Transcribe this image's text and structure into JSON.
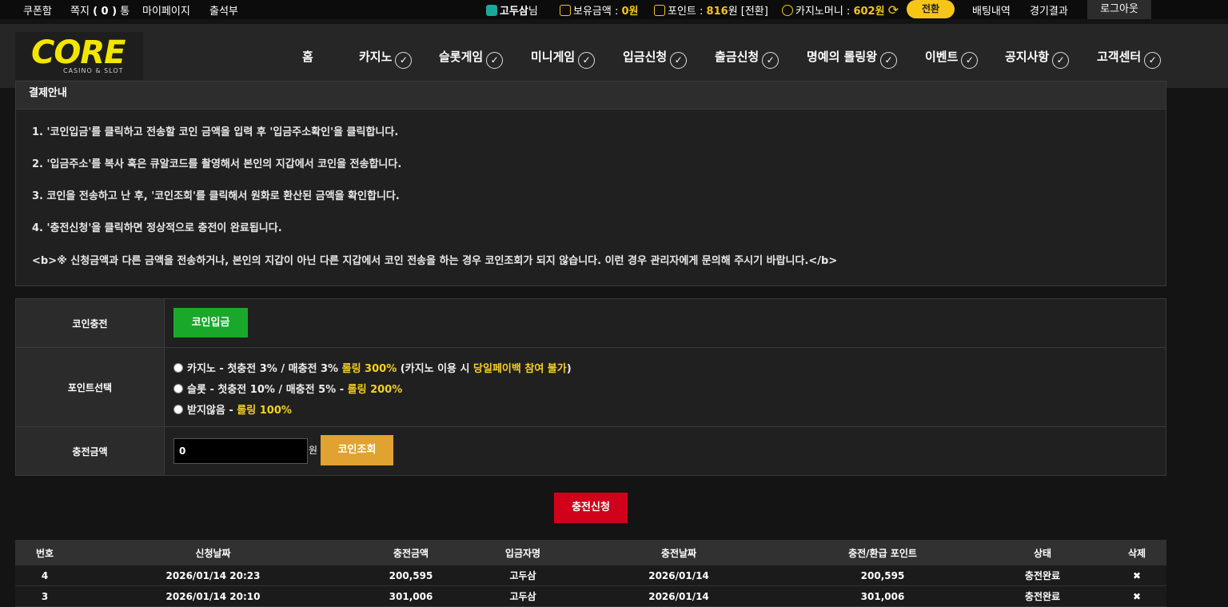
{
  "topbar": {
    "left_links": [
      "쿠폰함",
      "쪽지",
      "마이페이지",
      "출석부"
    ],
    "note_count": "( 0 )",
    "note_suffix": "통",
    "username": "고두삼",
    "username_suffix": "님",
    "balance_label": "보유금액 :",
    "balance_value": "0원",
    "point_label": "포인트 :",
    "point_value": "816",
    "point_suffix": "원 [전환]",
    "casino_label": "카지노머니 :",
    "casino_value": "602원",
    "switch_label": "전환",
    "betting_history": "배팅내역",
    "game_results": "경기결과",
    "logout": "로그아웃",
    "colors": {
      "gold": "#f5c518",
      "user_icon": "#1aa89a"
    }
  },
  "header": {
    "logo_text": "CORE",
    "logo_sub": "CASINO & SLOT",
    "nav": [
      "홈",
      "카지노",
      "슬롯게임",
      "미니게임",
      "입금신청",
      "출금신청",
      "명예의 롤링왕",
      "이벤트",
      "공지사항",
      "고객센터"
    ]
  },
  "info": {
    "title": "결제안내",
    "lines": [
      "1. '코인입금'를 클릭하고 전송할 코인 금액을 입력 후 '입금주소확인'을 클릭합니다.",
      "2. '입금주소'를 복사 혹은 큐알코드를 촬영해서 본인의 지갑에서 코인을 전송합니다.",
      "3. 코인을 전송하고 난 후, '코인조회'를 클릭해서 원화로 환산된 금액을 확인합니다.",
      "4. '충전신청'을 클릭하면 정상적으로 충전이 완료됩니다.",
      "<b>※ 신청금액과 다른 금액을 전송하거나, 본인의 지갑이 아닌 다른 지갑에서 코인 전송을 하는 경우 코인조회가 되지 않습니다. 이런 경우 관리자에게 문의해 주시기 바랍니다.</b>"
    ]
  },
  "form": {
    "coin_label": "코인충전",
    "coin_button": "코인입금",
    "point_label": "포인트선택",
    "options": [
      {
        "main": "카지노 - 첫충전 3% / 매충전 3% ",
        "hl": "롤링 300%",
        "tail1": " (카지노 이용 시 ",
        "hl2": "당일페이백 참여 불가",
        "tail2": ")"
      },
      {
        "main": "슬롯 - 첫충전 10% / 매충전 5% - ",
        "hl": "롤링 200%"
      },
      {
        "main": "받지않음 - ",
        "hl": "롤링 100%"
      }
    ],
    "amount_label": "충전금액",
    "amount_value": "0",
    "amount_unit": "원",
    "lookup_button": "코인조회",
    "submit_button": "충전신청"
  },
  "history": {
    "headers": [
      "번호",
      "신청날짜",
      "충전금액",
      "입금자명",
      "충전날짜",
      "충전/환급 포인트",
      "상태",
      "삭제"
    ],
    "rows": [
      [
        "4",
        "2026/01/14 20:23",
        "200,595",
        "고두삼",
        "2026/01/14",
        "200,595",
        "충전완료",
        "✖"
      ],
      [
        "3",
        "2026/01/14 20:10",
        "301,006",
        "고두삼",
        "2026/01/14",
        "301,006",
        "충전완료",
        "✖"
      ]
    ]
  }
}
